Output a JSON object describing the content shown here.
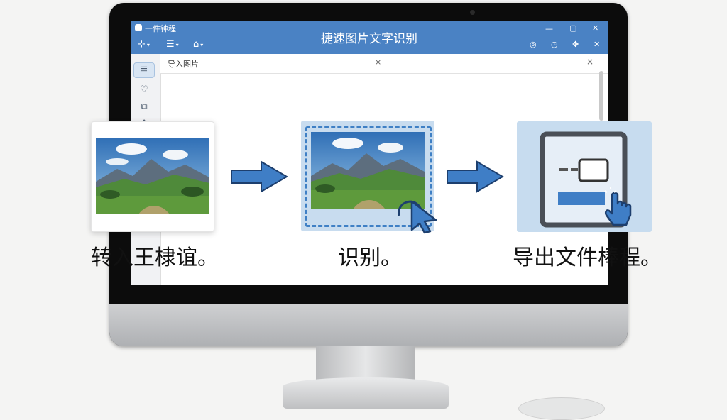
{
  "app": {
    "name": "一件钟程",
    "window_title": "捷速图片文字识别",
    "toolbar_icons": [
      "layout-icon",
      "list-icon",
      "house-icon"
    ],
    "window_controls": [
      "minimize-icon",
      "maximize-icon",
      "close-icon"
    ],
    "extra_controls": [
      "headset-icon",
      "timer-icon",
      "settings-icon"
    ]
  },
  "sidebar": {
    "items": [
      {
        "icon": "document-list-icon",
        "active": true
      },
      {
        "icon": "filter-icon",
        "active": false
      },
      {
        "icon": "share-icon",
        "active": false
      },
      {
        "icon": "tag-icon",
        "active": false
      }
    ]
  },
  "tab": {
    "label": "导入图片",
    "close": "×"
  },
  "pane": {
    "close": "×"
  },
  "steps": [
    {
      "label": "转入王棣谊。"
    },
    {
      "label": "识别。"
    },
    {
      "label": "导出文件棒程。"
    }
  ],
  "colors": {
    "titlebar": "#4a82c4",
    "arrow": "#3f7ec6",
    "highlight": "#c8dcef"
  }
}
